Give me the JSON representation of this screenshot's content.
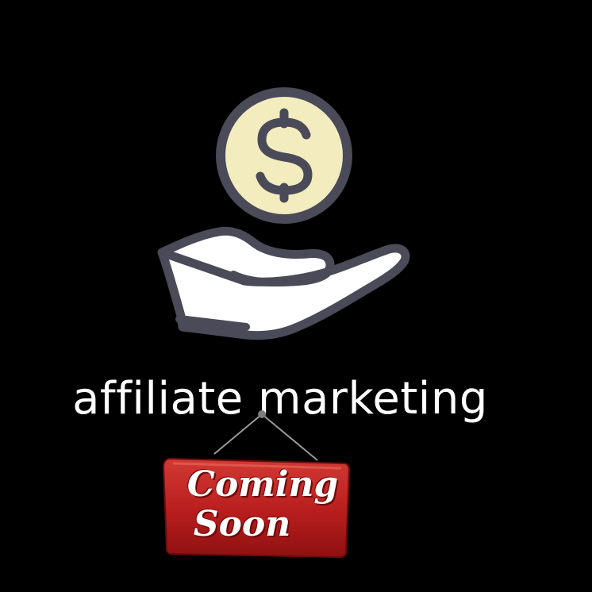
{
  "headline": "affiliate marketing",
  "icon": "hand-holding-dollar-icon",
  "sign": {
    "line1": "Coming",
    "line2": "Soon",
    "icon": "hanging-sign"
  },
  "colors": {
    "background": "#000000",
    "coin_fill": "#F2ECBE",
    "outline": "#4A4A58",
    "hand_fill": "#FFFFFF",
    "sign_red": "#B81D1D",
    "text": "#FFFFFF"
  }
}
